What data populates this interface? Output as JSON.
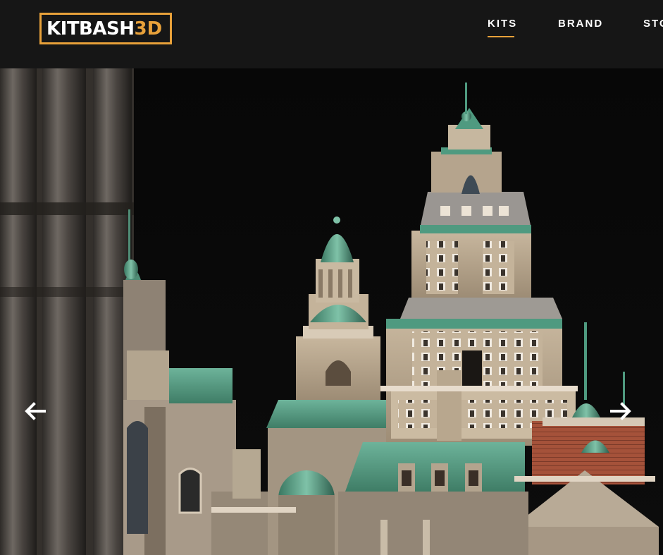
{
  "header": {
    "logo": {
      "text_main": "KITBASH",
      "text_accent": "3D"
    },
    "nav": [
      {
        "label": "KITS",
        "active": true
      },
      {
        "label": "BRAND",
        "active": false
      },
      {
        "label": "STO",
        "active": false
      }
    ]
  },
  "hero": {
    "prev_icon": "arrow-left-icon",
    "next_icon": "arrow-right-icon"
  },
  "colors": {
    "accent": "#e8a13a",
    "background": "#161616",
    "copper_green": "#4f9a80",
    "stone": "#b9a78f"
  }
}
